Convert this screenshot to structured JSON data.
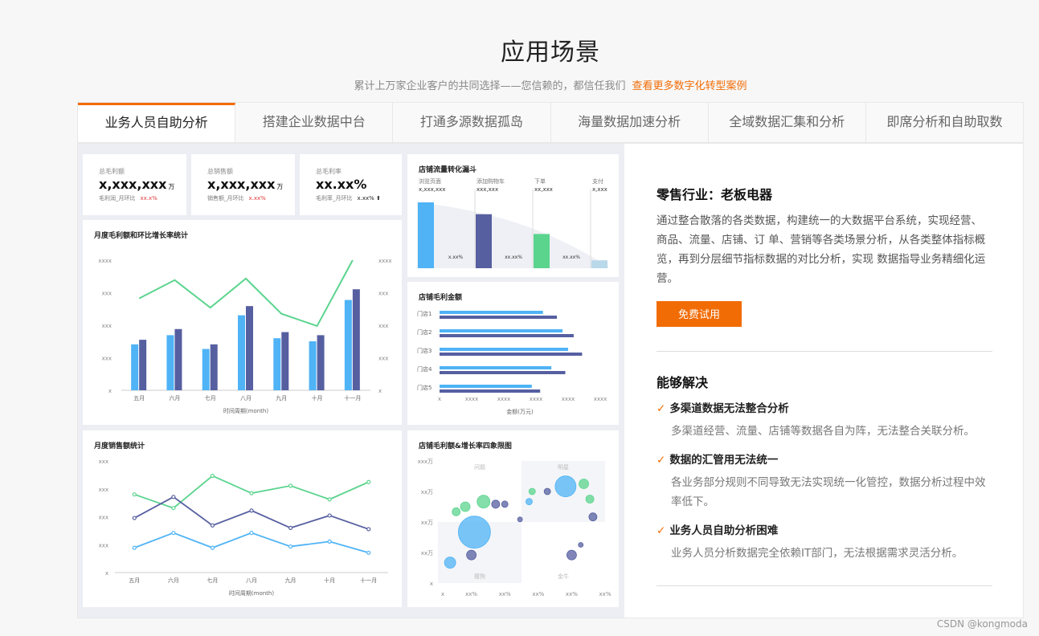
{
  "header": {
    "title": "应用场景",
    "subtitle": "累计上万家企业客户的共同选择——您信赖的，都信任我们",
    "link": "查看更多数字化转型案例"
  },
  "tabs": [
    {
      "label": "业务人员自助分析",
      "active": true
    },
    {
      "label": "搭建企业数据中台",
      "active": false
    },
    {
      "label": "打通多源数据孤岛",
      "active": false
    },
    {
      "label": "海量数据加速分析",
      "active": false
    },
    {
      "label": "全域数据汇集和分析",
      "active": false
    },
    {
      "label": "即席分析和自助取数",
      "active": false
    }
  ],
  "kpis": [
    {
      "label": "总毛利额",
      "value": "x,xxx,xxx",
      "unit": "万",
      "sub": "毛利润_月环比",
      "change": "xx.x%",
      "change_color": "#e23b3b"
    },
    {
      "label": "总销售额",
      "value": "x,xxx,xxx",
      "unit": "万",
      "sub": "销售额_月环比",
      "change": "x.xx%",
      "change_color": "#e23b3b"
    },
    {
      "label": "总毛利率",
      "value": "xx.xx%",
      "unit": "",
      "sub": "毛利率_月环比",
      "change": "x.xx% ⬆",
      "change_color": "#222"
    }
  ],
  "chart_data": [
    {
      "type": "bar",
      "title": "月度毛利额和环比增长率统计",
      "xlabel": "时间周期(month)",
      "categories": [
        "五月",
        "六月",
        "七月",
        "八月",
        "九月",
        "十月",
        "十一月"
      ],
      "left_ticks": [
        "x",
        "xxx",
        "xxx",
        "xxx",
        "xxxx"
      ],
      "right_ticks": [
        "x",
        "xxx",
        "xxx",
        "xxx",
        "xxxx"
      ],
      "series": [
        {
          "kind": "bar",
          "color": "#4fb3f6",
          "values": [
            30,
            36,
            27,
            49,
            34,
            32,
            59
          ]
        },
        {
          "kind": "bar",
          "color": "#565fa0",
          "values": [
            33,
            40,
            30,
            55,
            38,
            36,
            66
          ]
        },
        {
          "kind": "line",
          "color": "#5bd48e",
          "values": [
            60,
            72,
            54,
            73,
            50,
            42,
            85
          ]
        }
      ],
      "ylim": [
        0,
        85
      ]
    },
    {
      "type": "line",
      "title": "月度销售额统计",
      "xlabel": "时间周期(month)",
      "categories": [
        "五月",
        "六月",
        "七月",
        "八月",
        "九月",
        "十月",
        "十一月"
      ],
      "y_ticks": [
        "x",
        "xxx",
        "xxx",
        "xxx",
        "xxx"
      ],
      "series": [
        {
          "color": "#5bd48e",
          "values": [
            63,
            52,
            78,
            64,
            70,
            59,
            73
          ]
        },
        {
          "color": "#565fa0",
          "values": [
            44,
            61,
            38,
            50,
            36,
            46,
            35
          ]
        },
        {
          "color": "#4fb3f6",
          "values": [
            20,
            32,
            20,
            32,
            21,
            25,
            16
          ]
        }
      ],
      "ylim": [
        0,
        90
      ]
    },
    {
      "type": "bar",
      "title": "店铺流量转化漏斗",
      "categories": [
        "浏览页面",
        "添加购物车",
        "下单",
        "支付"
      ],
      "values_text": [
        "x,xxx,xxx",
        "xxx,xxx",
        "xx,xxx",
        "x,xxx"
      ],
      "rates": [
        "x.xx%",
        "xx.xx%",
        "xx.xx%"
      ],
      "colors": [
        "#4fb3f6",
        "#565fa0",
        "#5bd48e",
        "#b9d8ea"
      ],
      "values": [
        100,
        82,
        52,
        12
      ]
    },
    {
      "type": "bar",
      "title": "店铺毛利金额",
      "xlabel": "金额(万元)",
      "categories": [
        "门店1",
        "门店2",
        "门店3",
        "门店4",
        "门店5"
      ],
      "x_ticks": [
        "x",
        "xxxx",
        "xxxx",
        "xxxx",
        "xxxx",
        "xxxx"
      ],
      "series": [
        {
          "color": "#4fb3f6",
          "values": [
            74,
            88,
            92,
            80,
            66
          ]
        },
        {
          "color": "#565fa0",
          "values": [
            84,
            96,
            102,
            90,
            72
          ]
        }
      ],
      "xlim": [
        0,
        115
      ]
    },
    {
      "type": "scatter",
      "title": "店铺毛利额&增长率四象限图",
      "quadrants": [
        "问题",
        "明星",
        "瘦狗",
        "金牛"
      ],
      "y_ticks": [
        "x",
        "xx万",
        "xx万",
        "xx万",
        "xxx万"
      ],
      "x_ticks": [
        "x",
        "xx%",
        "xx%",
        "xx%",
        "xx%",
        "xx%"
      ],
      "points": [
        {
          "x": 12,
          "y": 20,
          "r": 20,
          "color": "#4fb3f6"
        },
        {
          "x": 4,
          "y": 8,
          "r": 7,
          "color": "#4fb3f6"
        },
        {
          "x": 11,
          "y": 11,
          "r": 6,
          "color": "#565fa0"
        },
        {
          "x": 6,
          "y": 28,
          "r": 5,
          "color": "#5bd48e"
        },
        {
          "x": 9,
          "y": 30,
          "r": 6,
          "color": "#5bd48e"
        },
        {
          "x": 15,
          "y": 32,
          "r": 8,
          "color": "#5bd48e"
        },
        {
          "x": 19,
          "y": 31,
          "r": 5,
          "color": "#565fa0"
        },
        {
          "x": 22,
          "y": 31,
          "r": 4,
          "color": "#565fa0"
        },
        {
          "x": 27,
          "y": 25,
          "r": 3,
          "color": "#565fa0"
        },
        {
          "x": 30,
          "y": 32,
          "r": 4,
          "color": "#4fb3f6"
        },
        {
          "x": 31,
          "y": 36,
          "r": 4,
          "color": "#5bd48e"
        },
        {
          "x": 36,
          "y": 36,
          "r": 4,
          "color": "#565fa0"
        },
        {
          "x": 42,
          "y": 38,
          "r": 13,
          "color": "#4fb3f6"
        },
        {
          "x": 48,
          "y": 39,
          "r": 6,
          "color": "#5bd48e"
        },
        {
          "x": 50,
          "y": 33,
          "r": 5,
          "color": "#5bd48e"
        },
        {
          "x": 47,
          "y": 15,
          "r": 3,
          "color": "#565fa0"
        },
        {
          "x": 51,
          "y": 26,
          "r": 5,
          "color": "#565fa0"
        },
        {
          "x": 44,
          "y": 11,
          "r": 6,
          "color": "#565fa0"
        }
      ],
      "xlim": [
        0,
        55
      ],
      "ylim": [
        0,
        48
      ]
    }
  ],
  "detail": {
    "case_title": "零售行业：老板电器",
    "description": "通过整合散落的各类数据，构建统一的大数据平台系统，实现经营、商品、流量、店铺、订 单、营销等各类场景分析，从各类整体指标概览，再到分层细节指标数据的对比分析，实现 数据指导业务精细化运营。",
    "trial_button": "免费试用",
    "solve_title": "能够解决",
    "check_icon": "check-icon",
    "items": [
      {
        "title": "多渠道数据无法整合分析",
        "desc": "多渠道经营、流量、店铺等数据各自为阵，无法整合关联分析。"
      },
      {
        "title": "数据的汇管用无法统一",
        "desc": "各业务部分规则不同导致无法实现统一化管控，数据分析过程中效率低下。"
      },
      {
        "title": "业务人员自助分析困难",
        "desc": "业务人员分析数据完全依赖IT部门，无法根据需求灵活分析。"
      }
    ]
  },
  "watermark": "CSDN @kongmoda",
  "colors": {
    "accent": "#f26c05"
  }
}
